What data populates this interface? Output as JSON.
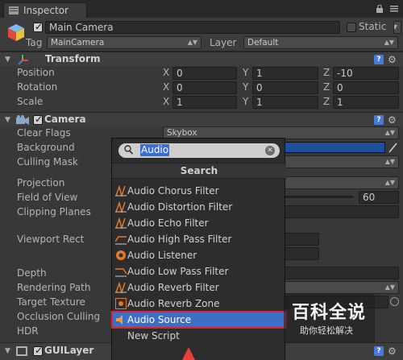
{
  "tab": {
    "label": "Inspector",
    "icon": "inspector-icon",
    "lock": "lock-icon",
    "menu": "menu-icon"
  },
  "gameobject": {
    "name": "Main Camera",
    "static_label": "Static",
    "tag_label": "Tag",
    "tag_value": "MainCamera",
    "layer_label": "Layer",
    "layer_value": "Default"
  },
  "transform": {
    "title": "Transform",
    "rows": [
      {
        "label": "Position",
        "x": "0",
        "y": "1",
        "z": "-10"
      },
      {
        "label": "Rotation",
        "x": "0",
        "y": "0",
        "z": "0"
      },
      {
        "label": "Scale",
        "x": "1",
        "y": "1",
        "z": "1"
      }
    ],
    "axes": {
      "x": "X",
      "y": "Y",
      "z": "Z"
    }
  },
  "camera": {
    "title": "Camera",
    "clear_flags_label": "Clear Flags",
    "clear_flags_value": "Skybox",
    "background_label": "Background",
    "culling_mask_label": "Culling Mask",
    "projection_label": "Projection",
    "fov_label": "Field of View",
    "fov_value": "60",
    "clipping_label": "Clipping Planes",
    "viewport_label": "Viewport Rect",
    "depth_label": "Depth",
    "rendering_path_label": "Rendering Path",
    "target_texture_label": "Target Texture",
    "occlusion_label": "Occlusion Culling",
    "hdr_label": "HDR",
    "background_color": "#1f4e9a"
  },
  "guilayer": {
    "title": "GUILayer"
  },
  "popup": {
    "search_value": "Audio",
    "title": "Search",
    "items": [
      {
        "label": "Audio Chorus Filter",
        "icon": "audio-filter-icon"
      },
      {
        "label": "Audio Distortion Filter",
        "icon": "audio-filter-icon"
      },
      {
        "label": "Audio Echo Filter",
        "icon": "audio-filter-icon"
      },
      {
        "label": "Audio High Pass Filter",
        "icon": "audio-filter-icon"
      },
      {
        "label": "Audio Listener",
        "icon": "audio-listener-icon"
      },
      {
        "label": "Audio Low Pass Filter",
        "icon": "audio-filter-icon"
      },
      {
        "label": "Audio Reverb Filter",
        "icon": "audio-filter-icon"
      },
      {
        "label": "Audio Reverb Zone",
        "icon": "audio-reverb-zone-icon"
      },
      {
        "label": "Audio Source",
        "icon": "audio-source-icon"
      },
      {
        "label": "New Script",
        "icon": ""
      }
    ],
    "selected_index": 8
  },
  "watermark": {
    "main": "百科全说",
    "sub": "助你轻松解决"
  },
  "colors": {
    "accent": "#3d6ec6",
    "highlight_border": "#d8242d",
    "arrow": "#e8403a"
  }
}
